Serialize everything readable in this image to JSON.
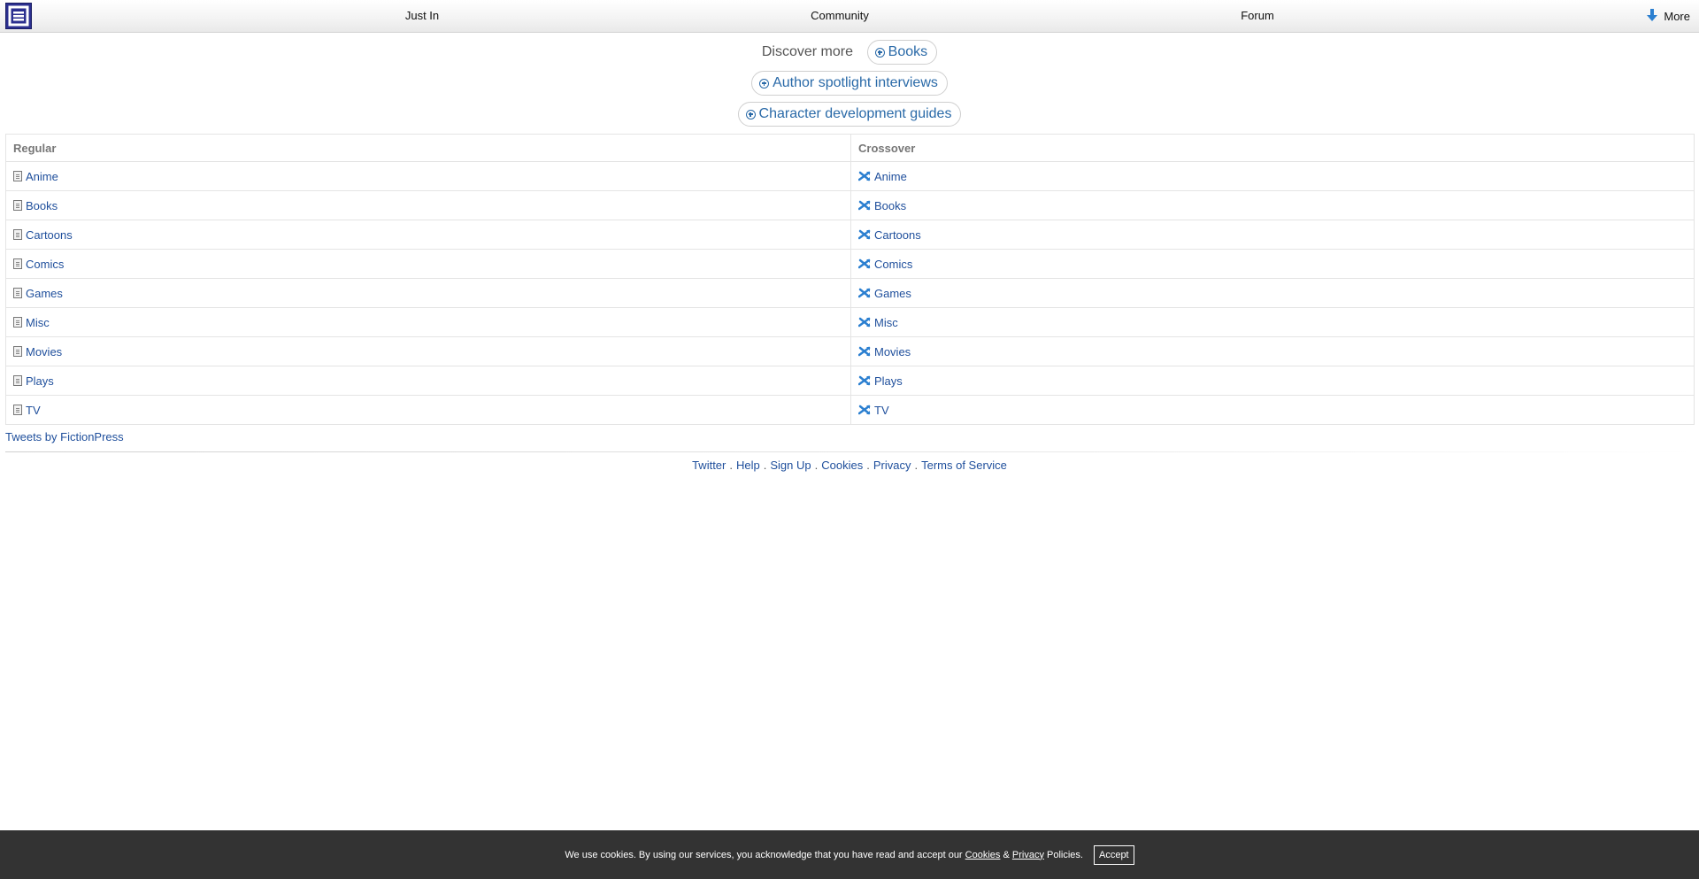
{
  "nav": {
    "items": [
      "Just In",
      "Community",
      "Forum"
    ],
    "more_label": "More"
  },
  "discover": {
    "label": "Discover more",
    "pills": [
      "Books",
      "Author spotlight interviews",
      "Character development guides"
    ]
  },
  "table": {
    "headers": [
      "Regular",
      "Crossover"
    ],
    "regular": [
      "Anime",
      "Books",
      "Cartoons",
      "Comics",
      "Games",
      "Misc",
      "Movies",
      "Plays",
      "TV"
    ],
    "crossover": [
      "Anime",
      "Books",
      "Cartoons",
      "Comics",
      "Games",
      "Misc",
      "Movies",
      "Plays",
      "TV"
    ]
  },
  "tweets_link": "Tweets by FictionPress",
  "footer": {
    "links": [
      "Twitter",
      "Help",
      "Sign Up",
      "Cookies",
      "Privacy",
      "Terms of Service"
    ],
    "separator": "."
  },
  "cookie_bar": {
    "text_before": "We use cookies. By using our services, you acknowledge that you have read and accept our",
    "cookies_link": "Cookies",
    "amp": "&",
    "privacy_link": "Privacy",
    "text_after": "Policies.",
    "accept_label": "Accept"
  },
  "colors": {
    "link": "#1f4f9c",
    "pill_text": "#2a6aa8",
    "logo": "#2b2f8f",
    "cookie_bg": "#333333"
  }
}
